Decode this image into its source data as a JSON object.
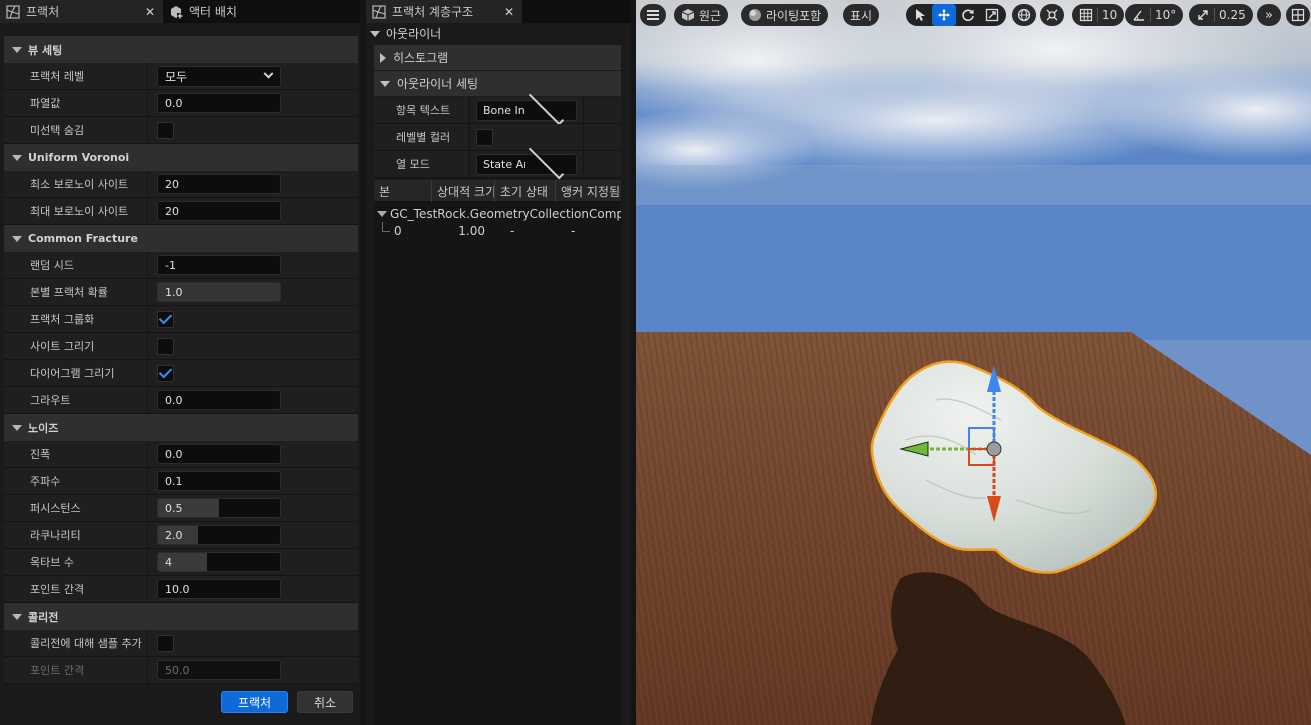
{
  "left_panel": {
    "tabs": [
      {
        "label": "프랙처"
      },
      {
        "label": "액터 배치"
      }
    ],
    "sections": {
      "view": {
        "title": "뷰 세팅",
        "fracture_level_label": "프랙처 레벨",
        "fracture_level_value": "모두",
        "explode_label": "파열값",
        "explode_value": "0.0",
        "hide_unselected_label": "미선택 숨김",
        "hide_unselected_checked": false
      },
      "voronoi": {
        "title": "Uniform Voronoi",
        "min_sites_label": "최소 보로노이 사이트",
        "min_sites_value": "20",
        "max_sites_label": "최대 보로노이 사이트",
        "max_sites_value": "20"
      },
      "common": {
        "title": "Common Fracture",
        "random_seed_label": "랜덤 시드",
        "random_seed_value": "-1",
        "chance_label": "본별 프랙처 확률",
        "chance_value": "1.0",
        "group_label": "프랙처 그룹화",
        "group_checked": true,
        "draw_sites_label": "사이트 그리기",
        "draw_sites_checked": false,
        "draw_diagram_label": "다이어그램 그리기",
        "draw_diagram_checked": true,
        "grout_label": "그라우트",
        "grout_value": "0.0"
      },
      "noise": {
        "title": "노이즈",
        "amplitude_label": "진폭",
        "amplitude_value": "0.0",
        "frequency_label": "주파수",
        "frequency_value": "0.1",
        "persistence_label": "퍼시스턴스",
        "persistence_value": "0.5",
        "persistence_fill": 0.5,
        "lacunarity_label": "라쿠나리티",
        "lacunarity_value": "2.0",
        "lacunarity_fill": 0.33,
        "octave_label": "옥타브 수",
        "octave_value": "4",
        "octave_fill": 0.4,
        "point_spacing_label": "포인트 간격",
        "point_spacing_value": "10.0"
      },
      "collision": {
        "title": "콜리전",
        "add_samples_label": "콜리전에 대해 샘플 추가",
        "add_samples_checked": false,
        "point_spacing_label": "포인트 간격",
        "point_spacing_value": "50.0"
      }
    },
    "footer": {
      "fracture_button": "프랙처",
      "cancel_button": "취소"
    }
  },
  "middle_panel": {
    "tab_label": "프랙처 계층구조",
    "outliner_title": "아웃라이너",
    "histogram_title": "히스토그램",
    "outliner_settings_title": "아웃라이너 세팅",
    "item_text_label": "항목 텍스트",
    "item_text_value": "Bone Index",
    "color_by_level_label": "레벨별 컬러",
    "color_by_level_checked": false,
    "column_mode_label": "열 모드",
    "column_mode_value": "State And Size",
    "columns": [
      "본",
      "상대적 크기",
      "초기 상태",
      "앵커 지정됨"
    ],
    "tree": {
      "root": "GC_TestRock.GeometryCollectionComponent",
      "child_bone": "0",
      "child_size": "1.00",
      "child_state": "-",
      "child_anchor": "-"
    }
  },
  "viewport": {
    "toolbar": {
      "perspective_label": "원근",
      "lighting_label": "라이팅포함",
      "show_label": "표시",
      "grid_snap_value": "10",
      "rotate_snap_value": "10°",
      "scale_snap_value": "0.25"
    },
    "colors": {
      "selection_outline": "#f2a11e",
      "gizmo_z": "#3f86f0",
      "gizmo_x": "#d84a1c",
      "gizmo_y": "#6fb83a",
      "accent": "#0d6ad8"
    }
  }
}
